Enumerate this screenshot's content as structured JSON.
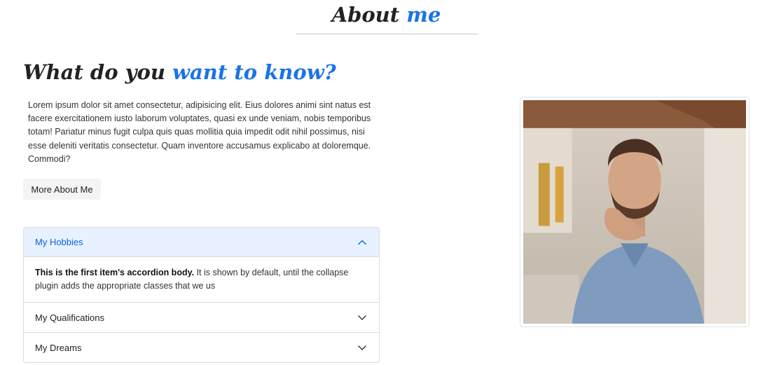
{
  "about": {
    "title_main": "About",
    "title_accent": "me"
  },
  "intro": {
    "heading_main": "What do you",
    "heading_accent": "want to know?",
    "paragraph": "Lorem ipsum dolor sit amet consectetur, adipisicing elit. Eius dolores animi sint natus est facere exercitationem iusto laborum voluptates, quasi ex unde veniam, nobis temporibus totam! Pariatur minus fugit culpa quis quas mollitia quia impedit odit nihil possimus, nisi esse deleniti veritatis consectetur. Quam inventore accusamus explicabo at doloremque. Commodi?",
    "button_label": "More About Me"
  },
  "accordion": {
    "items": [
      {
        "label": "My Hobbies",
        "expanded": true,
        "body_bold": "This is the first item's accordion body.",
        "body_text": " It is shown by default, until the collapse plugin adds the appropriate classes that we us"
      },
      {
        "label": "My Qualifications",
        "expanded": false
      },
      {
        "label": "My Dreams",
        "expanded": false
      }
    ]
  },
  "colors": {
    "accent": "#1a73e8",
    "accordion_active_bg": "#e7f1ff",
    "accordion_active_text": "#0c63e4"
  },
  "icons": {
    "expanded": "chevron-up-icon",
    "collapsed": "chevron-down-icon"
  }
}
